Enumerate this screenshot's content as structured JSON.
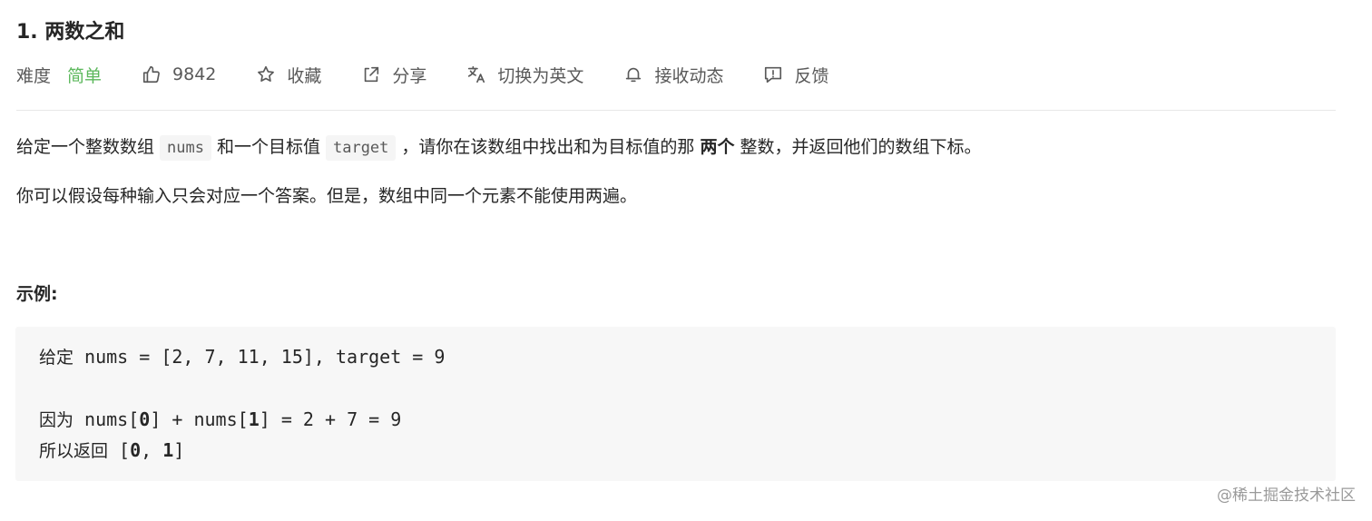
{
  "problem": {
    "title": "1. 两数之和",
    "difficulty_label": "难度",
    "difficulty_value": "简单",
    "likes": "9842",
    "favorite_label": "收藏",
    "share_label": "分享",
    "switch_lang_label": "切换为英文",
    "notify_label": "接收动态",
    "feedback_label": "反馈"
  },
  "description": {
    "p1_a": "给定一个整数数组",
    "code_nums": "nums",
    "p1_b": "和一个目标值",
    "code_target": "target",
    "p1_c": "，请你在该数组中找出和为目标值的那",
    "p1_bold": "两个",
    "p1_d": "整数，并返回他们的数组下标。",
    "p2": "你可以假设每种输入只会对应一个答案。但是，数组中同一个元素不能使用两遍。"
  },
  "example": {
    "label": "示例:",
    "line1_cjk": "给定",
    "line1_code": " nums = [2, 7, 11, 15], target = 9",
    "line2_cjk": "因为",
    "line2_a": " nums[",
    "line2_b0": "0",
    "line2_c": "] + nums[",
    "line2_b1": "1",
    "line2_d": "] = 2 + 7 = 9",
    "line3_cjk": "所以返回",
    "line3_a": " [",
    "line3_b0": "0",
    "line3_c": ", ",
    "line3_b1": "1",
    "line3_d": "]"
  },
  "watermark": "@稀土掘金技术社区",
  "colors": {
    "easy": "#5cb85c",
    "text": "#262626",
    "muted": "#595959",
    "code_bg": "#f7f7f7"
  },
  "icons": [
    "thumbs-up-icon",
    "star-icon",
    "share-icon",
    "translate-icon",
    "bell-icon",
    "feedback-icon"
  ]
}
